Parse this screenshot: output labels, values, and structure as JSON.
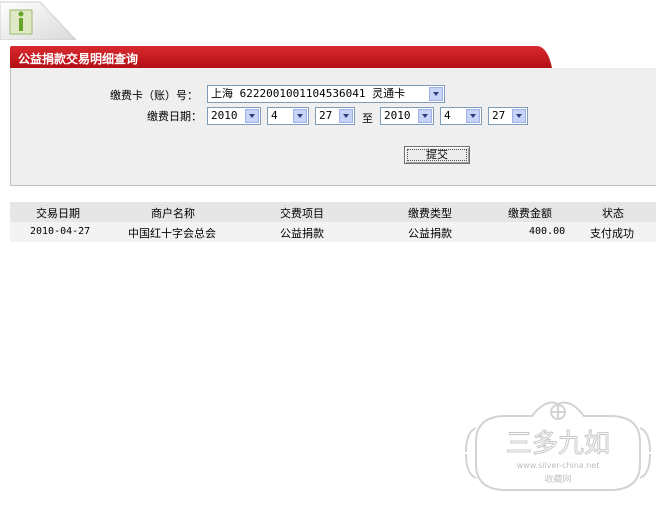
{
  "page": {
    "title": "公益捐款交易明细查询"
  },
  "form": {
    "account_label": "缴费卡（账）号：",
    "account_value": "上海  6222001001104536041 灵通卡",
    "date_label": "缴费日期：",
    "date_to": "至",
    "start": {
      "year": "2010",
      "month": "4",
      "day": "27"
    },
    "end": {
      "year": "2010",
      "month": "4",
      "day": "27"
    },
    "submit_label": "提交"
  },
  "table": {
    "headers": [
      "交易日期",
      "商户名称",
      "交费项目",
      "缴费类型",
      "缴费金额",
      "状态"
    ],
    "rows": [
      [
        "2010-04-27",
        "中国红十字会总会",
        "公益捐款",
        "公益捐款",
        "400.00",
        "支付成功"
      ]
    ]
  },
  "watermark": {
    "title": "三多九如",
    "url": "www.silver-china.net",
    "sub": "收藏网"
  },
  "colors": {
    "title_bar": "#c4161c",
    "panel_bg": "#efefef",
    "header_bg": "#e6e6e6"
  }
}
